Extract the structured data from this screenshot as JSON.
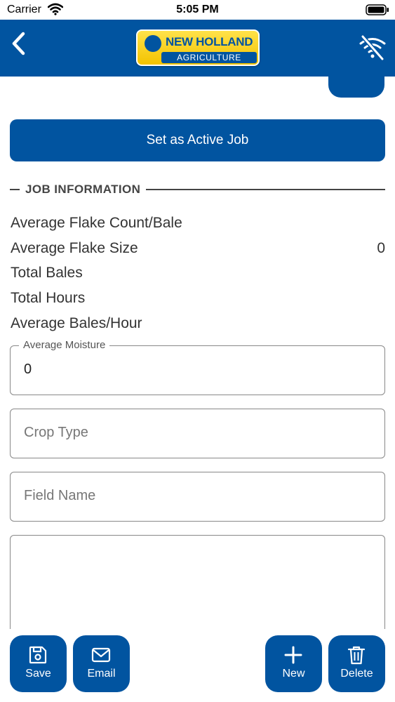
{
  "status_bar": {
    "carrier": "Carrier",
    "time": "5:05 PM"
  },
  "nav": {
    "back_icon": "chevron-left-icon",
    "logo": {
      "title": "NEW HOLLAND",
      "subtitle": "AGRICULTURE"
    },
    "connection_icon": "wifi-off-icon"
  },
  "colors": {
    "brand_blue": "#0154a0",
    "logo_yellow": "#f3c300"
  },
  "actions": {
    "set_active_job": "Set as Active Job"
  },
  "job_info": {
    "title": "JOB INFORMATION",
    "rows": [
      {
        "label": "Average Flake Count/Bale",
        "value": ""
      },
      {
        "label": "Average Flake Size",
        "value": "0"
      },
      {
        "label": "Total Bales",
        "value": ""
      },
      {
        "label": "Total Hours",
        "value": ""
      },
      {
        "label": "Average Bales/Hour",
        "value": ""
      }
    ]
  },
  "form": {
    "moisture": {
      "label": "Average Moisture",
      "value": "0"
    },
    "crop_type": {
      "placeholder": "Crop Type"
    },
    "field_name": {
      "placeholder": "Field Name"
    },
    "notes": {
      "value": ""
    }
  },
  "toolbar": {
    "save": "Save",
    "email": "Email",
    "new": "New",
    "delete": "Delete"
  }
}
